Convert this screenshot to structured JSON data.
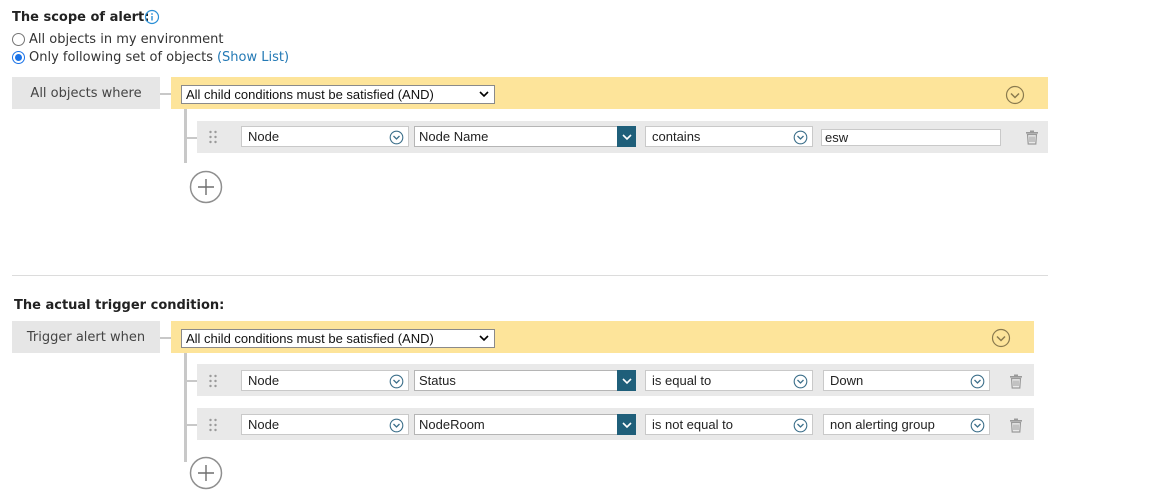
{
  "scope": {
    "heading": "The scope of alert:",
    "info_icon": "info-circle-icon",
    "radio_all": "All objects in my environment",
    "radio_only": "Only following set of objects",
    "show_list": "(Show List)",
    "selected": "only",
    "where_label": "All objects where",
    "group_operator": "All child conditions must be satisfied (AND)",
    "conditions": [
      {
        "object": "Node",
        "field": "Node Name",
        "operator": "contains",
        "value": "esw"
      }
    ]
  },
  "trigger": {
    "heading": "The actual trigger condition:",
    "when_label": "Trigger alert when",
    "group_operator": "All child conditions must be satisfied (AND)",
    "conditions": [
      {
        "object": "Node",
        "field": "Status",
        "operator": "is equal to",
        "value": "Down"
      },
      {
        "object": "Node",
        "field": "NodeRoom",
        "operator": "is not equal to",
        "value": "non alerting group"
      }
    ]
  },
  "colors": {
    "band": "#fde49a",
    "accent": "#1f5f7a",
    "link": "#2379b5"
  }
}
